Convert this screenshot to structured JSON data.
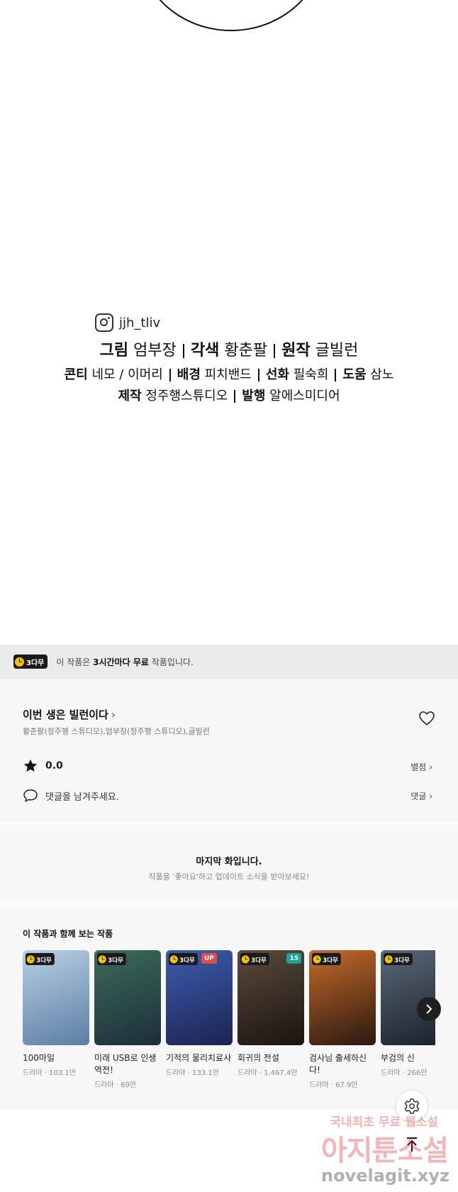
{
  "credits": {
    "instagram_handle": "jjh_tliv",
    "line1": [
      {
        "role": "그림",
        "name": "엄부장"
      },
      {
        "role": "각색",
        "name": "황춘팔"
      },
      {
        "role": "원작",
        "name": "글빌런"
      }
    ],
    "line2": [
      {
        "role": "콘티",
        "name": "네모 / 이머리"
      },
      {
        "role": "배경",
        "name": "피치밴드"
      },
      {
        "role": "선화",
        "name": "필숙희"
      },
      {
        "role": "도움",
        "name": "삼노"
      }
    ],
    "line3": [
      {
        "role": "제작",
        "name": "정주행스튜디오"
      },
      {
        "role": "발행",
        "name": "알에스미디어"
      }
    ]
  },
  "free_bar": {
    "badge": "3다무",
    "text_pre": "이 작품은 ",
    "text_bold": "3시간마다 무료",
    "text_post": " 작품입니다."
  },
  "series": {
    "title": "이번 생은 빌런이다",
    "authors": "황춘팔(정주행 스튜디오),엄부장(정주행 스튜디오),글빌런",
    "rating": "0.0",
    "rate_label": "별점",
    "comment_placeholder": "댓글을 남겨주세요.",
    "comment_label": "댓글"
  },
  "last_episode": {
    "title": "마지막 화입니다.",
    "subtitle": "작품을 '좋아요'하고 업데이트 소식을 받아보세요!"
  },
  "recommendations": {
    "title": "이 작품과 함께 보는 작품",
    "items": [
      {
        "name": "100마일",
        "meta": "드라마 · 103.1만",
        "badge": "3다무",
        "tag": "",
        "colors": [
          "#b7cfe3",
          "#5c7fa6"
        ]
      },
      {
        "name": "미래 USB로 인생역전!",
        "meta": "드라마 · 69만",
        "badge": "3다무",
        "tag": "",
        "colors": [
          "#3a6b5a",
          "#1d2e3a"
        ]
      },
      {
        "name": "기적의 물리치료사",
        "meta": "드라마 · 133.1만",
        "badge": "3다무",
        "tag": "UP",
        "colors": [
          "#3c5db0",
          "#1c2350"
        ]
      },
      {
        "name": "회귀의 전설",
        "meta": "드라마 · 1,467.4만",
        "badge": "3다무",
        "tag": "15",
        "colors": [
          "#5a4a3a",
          "#1a1410"
        ]
      },
      {
        "name": "검사님 출세하신다!",
        "meta": "드라마 · 67.9만",
        "badge": "3다무",
        "tag": "",
        "colors": [
          "#c56a2a",
          "#2a1810"
        ]
      },
      {
        "name": "부검의 신",
        "meta": "드라마 · 266만",
        "badge": "3다무",
        "tag": "",
        "colors": [
          "#5a6878",
          "#1a2028"
        ]
      }
    ]
  },
  "watermark": {
    "line1": "국내최초 무료 웹소설",
    "line2": "아지툰소설",
    "line3": "novelagit.xyz"
  },
  "colors": {
    "free_bar_bg": "#ebebeb",
    "panel_bg": "#f7f7f7",
    "badge_clock": "#f5c400",
    "tag_up": "#e84a4a",
    "tag_age": "#1aa39a"
  }
}
